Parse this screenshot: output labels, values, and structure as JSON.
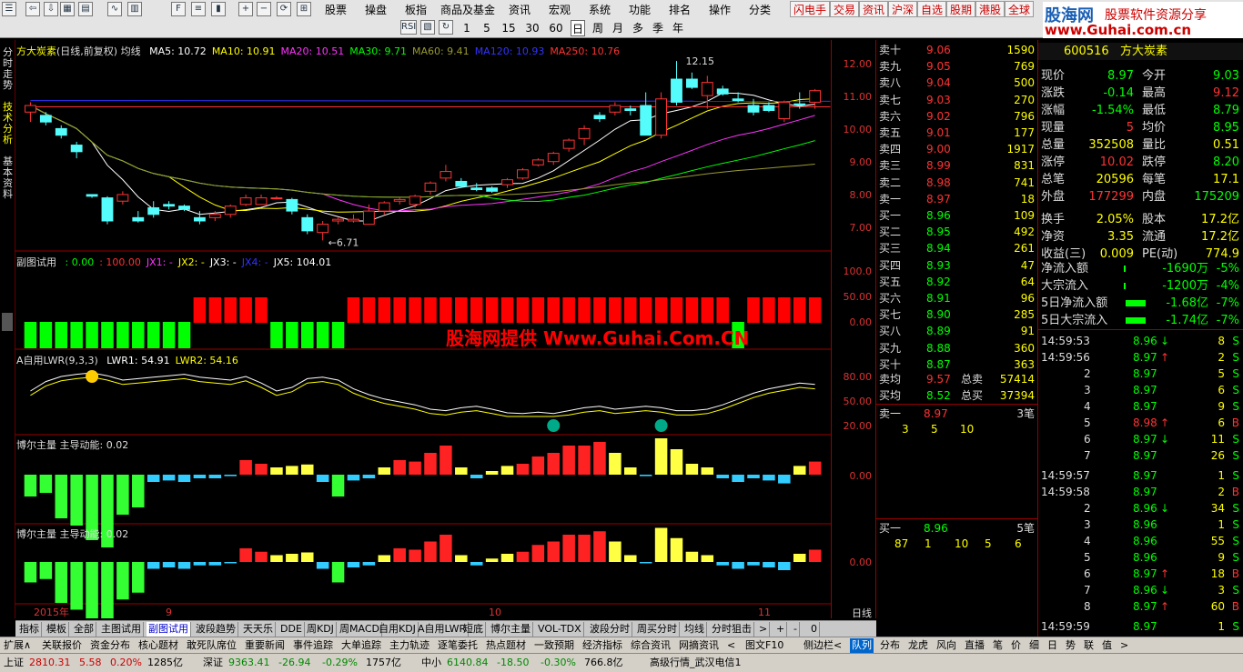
{
  "menu": [
    "股票",
    "操盘",
    "板指",
    "商品及基金",
    "资讯",
    "宏观",
    "系统",
    "功能",
    "排名",
    "操作",
    "分类"
  ],
  "quick": [
    "闪电手",
    "交易",
    "资讯",
    "沪深",
    "自选",
    "股期",
    "港股",
    "全球"
  ],
  "periods": [
    "1",
    "5",
    "15",
    "30",
    "60",
    "日",
    "周",
    "月",
    "多",
    "季",
    "年"
  ],
  "tools": [
    "RSI"
  ],
  "logo": {
    "l1": "股海网",
    "l2": "股票软件资源分享",
    "l3": "www.Guhai.com.cn"
  },
  "left_tabs": [
    "分时走势",
    "技术分析",
    "基本资料"
  ],
  "main_title": {
    "name": "方大炭素",
    "mode": "(日线,前复权)",
    "ind": "均线",
    "ma": [
      {
        "t": "MA5: 10.72",
        "c": "#ffffff"
      },
      {
        "t": "MA10: 10.91",
        "c": "#ffff00"
      },
      {
        "t": "MA20: 10.51",
        "c": "#ff33ff"
      },
      {
        "t": "MA30: 9.71",
        "c": "#00ff00"
      },
      {
        "t": "MA60: 9.41",
        "c": "#999933"
      },
      {
        "t": "MA120: 10.93",
        "c": "#3333ff"
      },
      {
        "t": "MA250: 10.76",
        "c": "#ff3333"
      }
    ],
    "high_label": "12.15",
    "low_label": "6.71"
  },
  "axis_main": [
    "12.00",
    "11.00",
    "10.00",
    "9.00",
    "8.00",
    "7.00"
  ],
  "pane2": {
    "title": "副图试用",
    "vals": [
      {
        "t": ": 0.00",
        "c": "#00ff00"
      },
      {
        "t": ": 100.00",
        "c": "#ff3333"
      },
      {
        "t": "JX1: -",
        "c": "#ff33ff"
      },
      {
        "t": "JX2: -",
        "c": "#ffff00"
      },
      {
        "t": "JX3: -",
        "c": "#ffffff"
      },
      {
        "t": "JX4: -",
        "c": "#3333ff"
      },
      {
        "t": "JX5: 104.01",
        "c": "#ffffff"
      }
    ],
    "axis": [
      "100.0",
      "50.00",
      "0.00"
    ]
  },
  "watermark": "股海网提供 Www.Guhai.Com.CN",
  "pane3": {
    "title": "A自用LWR(9,3,3)",
    "vals": [
      {
        "t": "LWR1: 54.91",
        "c": "#ffffff"
      },
      {
        "t": "LWR2: 54.16",
        "c": "#ffff00"
      }
    ],
    "axis": [
      "80.00",
      "50.00",
      "20.00"
    ]
  },
  "pane4": {
    "title": "博尔主量",
    "sub": "主导动能: 0.02",
    "axis": [
      "0.00"
    ]
  },
  "pane5": {
    "title": "博尔主量",
    "sub": "主导动能: 0.02",
    "axis": [
      "0.00"
    ]
  },
  "date_axis": [
    "2015年",
    "9",
    "10",
    "11"
  ],
  "period_label": "日线",
  "chart_data": {
    "type": "candlestick",
    "candles": [
      [
        10.6,
        10.9,
        10.3,
        10.8
      ],
      [
        10.5,
        10.6,
        10.2,
        10.3
      ],
      [
        10.1,
        10.2,
        9.8,
        9.9
      ],
      [
        9.6,
        9.7,
        9.2,
        9.4
      ],
      [
        8.1,
        8.1,
        8.0,
        8.05
      ],
      [
        8.0,
        8.05,
        7.2,
        7.3
      ],
      [
        7.9,
        8.2,
        7.8,
        8.1
      ],
      [
        7.4,
        7.6,
        7.25,
        7.3
      ],
      [
        7.7,
        7.9,
        7.4,
        7.5
      ],
      [
        7.8,
        7.9,
        7.65,
        7.75
      ],
      [
        7.75,
        7.8,
        7.6,
        7.65
      ],
      [
        7.4,
        7.6,
        7.2,
        7.3
      ],
      [
        7.4,
        7.6,
        7.3,
        7.5
      ],
      [
        7.5,
        7.8,
        7.4,
        7.75
      ],
      [
        7.8,
        8.1,
        7.75,
        8.0
      ],
      [
        7.8,
        8.1,
        7.8,
        8.0
      ],
      [
        8.0,
        8.05,
        7.95,
        8.0
      ],
      [
        7.95,
        8.0,
        7.5,
        7.6
      ],
      [
        7.4,
        7.5,
        6.9,
        7.0
      ],
      [
        6.95,
        7.3,
        6.71,
        7.2
      ],
      [
        7.3,
        7.4,
        7.2,
        7.35
      ],
      [
        7.3,
        7.5,
        7.25,
        7.35
      ],
      [
        7.2,
        7.8,
        7.2,
        7.6
      ],
      [
        7.6,
        7.9,
        7.5,
        7.85
      ],
      [
        7.9,
        8.0,
        7.8,
        7.95
      ],
      [
        7.8,
        8.1,
        7.7,
        8.05
      ],
      [
        8.2,
        8.5,
        8.1,
        8.45
      ],
      [
        8.6,
        9.0,
        8.5,
        8.8
      ],
      [
        8.5,
        8.6,
        8.3,
        8.35
      ],
      [
        8.3,
        8.45,
        8.2,
        8.25
      ],
      [
        8.3,
        8.35,
        8.15,
        8.2
      ],
      [
        8.4,
        8.6,
        8.3,
        8.55
      ],
      [
        8.6,
        8.9,
        8.55,
        8.85
      ],
      [
        9.0,
        9.2,
        8.95,
        9.15
      ],
      [
        9.1,
        9.4,
        9.0,
        9.35
      ],
      [
        9.5,
        9.8,
        9.4,
        9.75
      ],
      [
        9.8,
        10.2,
        9.6,
        10.1
      ],
      [
        10.5,
        10.6,
        10.3,
        10.4
      ],
      [
        10.6,
        10.9,
        10.5,
        10.8
      ],
      [
        10.7,
        10.8,
        10.5,
        10.65
      ],
      [
        10.8,
        11.2,
        9.9,
        9.9
      ],
      [
        9.9,
        11.2,
        9.8,
        11.0
      ],
      [
        11.6,
        12.15,
        10.8,
        10.9
      ],
      [
        11.6,
        11.8,
        11.3,
        11.35
      ],
      [
        11.1,
        11.7,
        10.7,
        11.5
      ],
      [
        11.3,
        11.4,
        11.1,
        11.15
      ],
      [
        11.0,
        11.2,
        10.9,
        10.95
      ],
      [
        10.8,
        11.0,
        10.5,
        10.6
      ],
      [
        10.8,
        10.9,
        10.6,
        10.65
      ],
      [
        10.4,
        10.95,
        10.3,
        10.9
      ],
      [
        10.85,
        11.2,
        10.7,
        10.8
      ],
      [
        10.9,
        11.3,
        10.7,
        11.25
      ]
    ],
    "ylim": [
      6.5,
      12.4
    ]
  }
}
